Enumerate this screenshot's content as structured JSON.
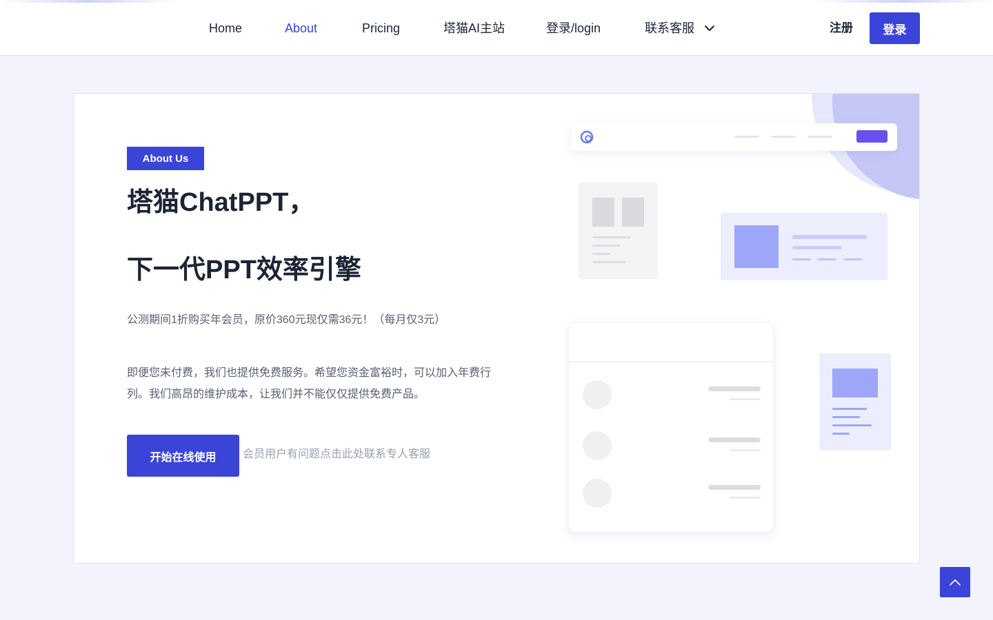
{
  "nav": {
    "items": [
      {
        "label": "Home",
        "active": false
      },
      {
        "label": "About",
        "active": true
      },
      {
        "label": "Pricing",
        "active": false
      },
      {
        "label": "塔猫AI主站",
        "active": false
      },
      {
        "label": "登录/login",
        "active": false
      },
      {
        "label": "联系客服",
        "active": false
      }
    ],
    "dropdown_icon": "chevron-down-icon",
    "signup_label": "注册",
    "login_label": "登录"
  },
  "hero": {
    "badge": "About Us",
    "title_line1": "塔猫ChatPPT，",
    "title_line2": "下一代PPT效率引擎",
    "promo": "公测期间1折购买年会员，原价360元现仅需36元！（每月仅3元）",
    "description": "即便您未付费，我们也提供免费服务。希望您资金富裕时，可以加入年费行列。我们高昂的维护成本，让我们并不能仅仅提供免费产品。",
    "cta_label": "开始在线使用",
    "support_link": "会员用户有问题点击此处联系专人客服"
  },
  "colors": {
    "accent": "#3b44d8",
    "text": "#1c2434",
    "muted": "#59606e",
    "background": "#f2f3fd"
  },
  "back_to_top_icon": "chevron-up-icon"
}
